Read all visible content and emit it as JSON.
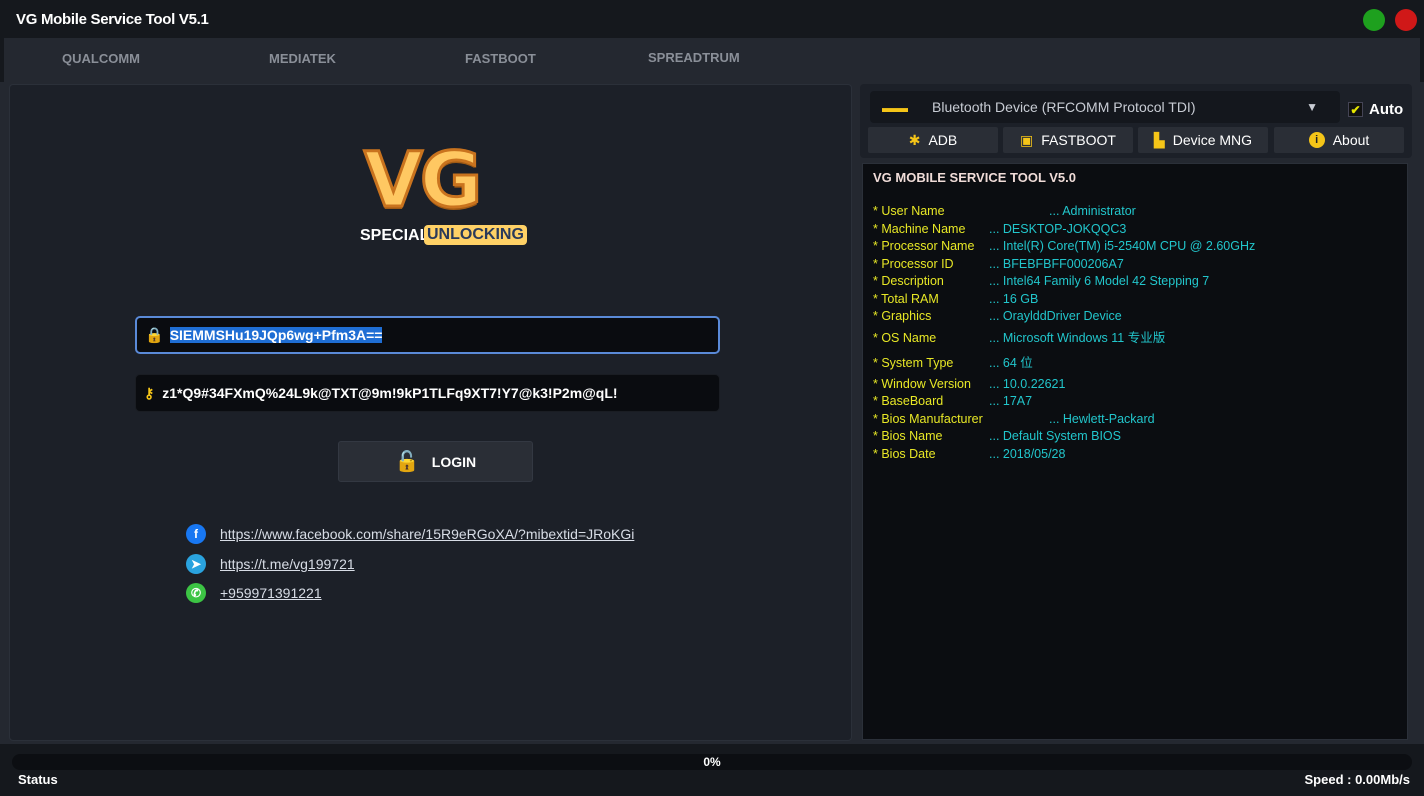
{
  "window": {
    "title": "VG Mobile Service Tool V5.1"
  },
  "tabs": [
    "QUALCOMM",
    "MEDIATEK",
    "FASTBOOT",
    "SPREADTRUM"
  ],
  "logo": {
    "vg": "VG",
    "special": "SPECIAL",
    "unlocking": "UNLOCKING"
  },
  "login": {
    "password_value": "SIEMMSHu19JQp6wg+Pfm3A==",
    "key_value": "z1*Q9#34FXmQ%24L9k@TXT@9m!9kP1TLFq9XT7!Y7@k3!P2m@qL!",
    "login_label": "LOGIN"
  },
  "links": {
    "facebook": "https://www.facebook.com/share/15R9eRGoXA/?mibextid=JRoKGi",
    "telegram": "https://t.me/vg199721",
    "whatsapp": "+959971391221"
  },
  "device": {
    "selected": "Bluetooth Device (RFCOMM Protocol TDI)",
    "auto_label": "Auto",
    "auto_checked": true
  },
  "buttons": {
    "adb": "ADB",
    "fastboot": "FASTBOOT",
    "device_mng": "Device MNG",
    "about": "About"
  },
  "info": {
    "title": "VG MOBILE SERVICE TOOL V5.0",
    "rows": [
      {
        "k": "* User Name",
        "v": "... Administrator"
      },
      {
        "k": "* Machine Name",
        "v": "... DESKTOP-JOKQQC3"
      },
      {
        "k": "* Processor Name",
        "v": "... Intel(R) Core(TM) i5-2540M CPU @ 2.60GHz"
      },
      {
        "k": "* Processor ID",
        "v": "... BFEBFBFF000206A7"
      },
      {
        "k": "* Description",
        "v": "... Intel64 Family 6 Model 42 Stepping 7"
      },
      {
        "k": "* Total RAM",
        "v": "... 16 GB"
      },
      {
        "k": "* Graphics",
        "v": "... OraylddDriver Device"
      },
      {
        "k": "* OS Name",
        "v": "... Microsoft Windows 11 专业版"
      },
      {
        "k": "* System Type",
        "v": "... 64 位"
      },
      {
        "k": "* Window Version",
        "v": "... 10.0.22621"
      },
      {
        "k": "* BaseBoard",
        "v": "... 17A7"
      },
      {
        "k": "* Bios Manufacturer",
        "v": "... Hewlett-Packard"
      },
      {
        "k": "* Bios Name",
        "v": "... Default System BIOS"
      },
      {
        "k": "* Bios Date",
        "v": "... 2018/05/28"
      }
    ]
  },
  "statusbar": {
    "progress": "0%",
    "status": "Status",
    "speed": "Speed : 0.00Mb/s"
  },
  "colors": {
    "accent": "#ffc862",
    "info_key": "#e8e826",
    "info_value": "#22c6cc"
  }
}
